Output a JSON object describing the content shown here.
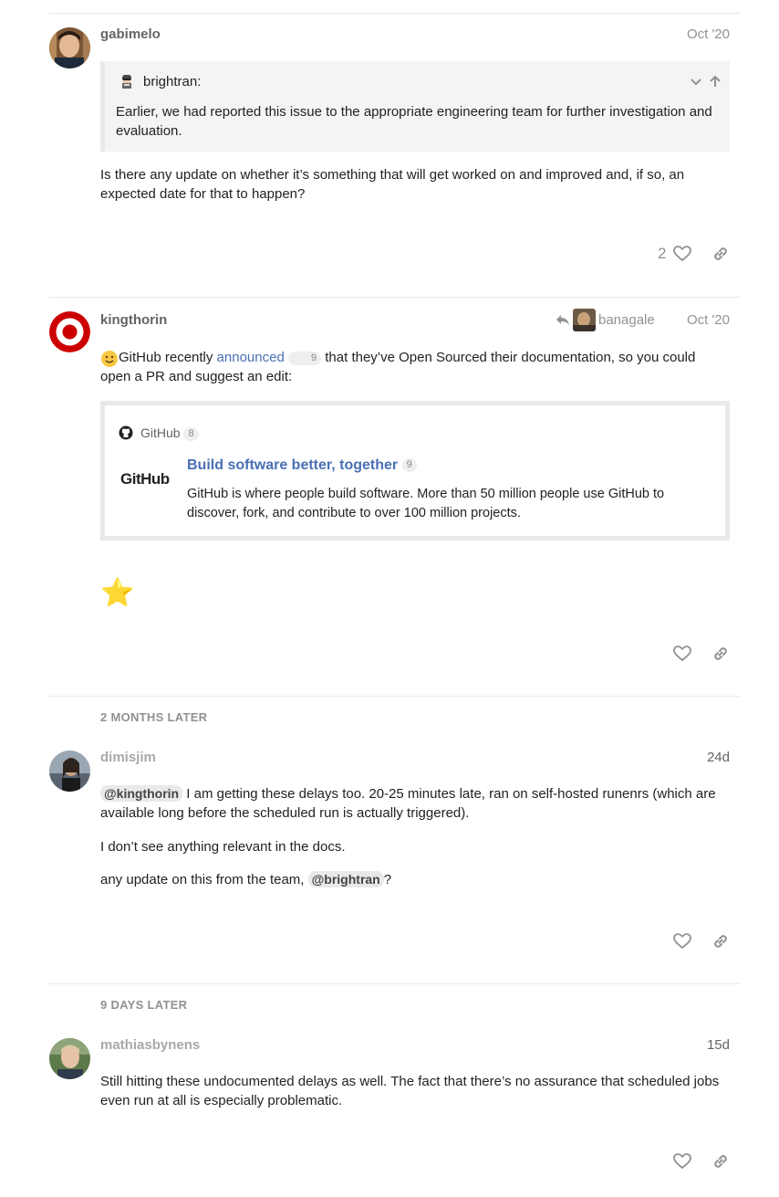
{
  "posts": [
    {
      "username": "gabimelo",
      "date": "Oct '20",
      "quote": {
        "author": "brightran:",
        "text": "Earlier, we had reported this issue to the appropriate engineering team for further investigation and evaluation."
      },
      "body": "Is there any update on whether it’s something that will get worked on and improved and, if so, an expected date for that to happen?",
      "likes": "2"
    },
    {
      "username": "kingthorin",
      "reply_to": "banagale",
      "date": "Oct '20",
      "body_pre": " GitHub recently ",
      "link_text": "announced",
      "link_clicks": "9",
      "body_post": " that they’ve Open Sourced their documentation, so you could open a PR and suggest an edit:",
      "onebox": {
        "source": "GitHub",
        "source_clicks": "8",
        "logo_text": "GitHub",
        "title": "Build software better, together",
        "title_clicks": "9",
        "description": "GitHub is where people build software. More than 50 million people use GitHub to discover, fork, and contribute to over 100 million projects."
      },
      "emoji": "⭐"
    },
    {
      "time_gap": "2 MONTHS LATER",
      "username": "dimisjim",
      "date": "24d",
      "mention1": "@kingthorin",
      "p1": " I am getting these delays too. 20-25 minutes late, ran on self-hosted runenrs (which are available long before the scheduled run is actually triggered).",
      "p2": "I don’t see anything relevant in the docs.",
      "p3_pre": "any update on this from the team, ",
      "mention2": "@brightran",
      "p3_post": "?"
    },
    {
      "time_gap": "9 DAYS LATER",
      "username": "mathiasbynens",
      "date": "15d",
      "body": "Still hitting these undocumented delays as well. The fact that there’s no assurance that scheduled jobs even run at all is especially problematic."
    }
  ],
  "icons": {
    "like": "heart-icon",
    "share": "link-icon",
    "expand": "chevron-down-icon",
    "jump": "arrow-up-icon",
    "reply": "reply-arrow-icon"
  }
}
